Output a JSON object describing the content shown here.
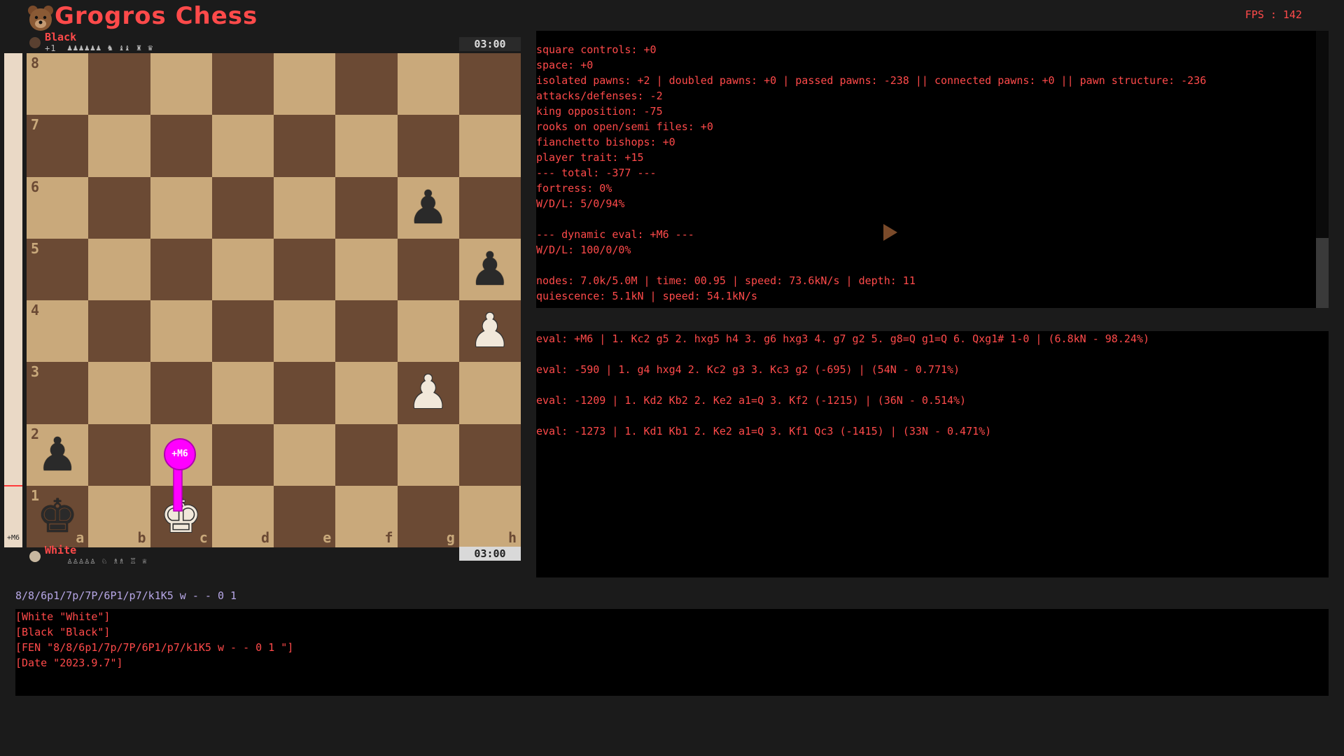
{
  "app": {
    "title": "Grogros Chess",
    "fps": "FPS : 142"
  },
  "players": {
    "top": {
      "name": "Black",
      "material_diff": "+1",
      "captured": "♟♟♟♟♟♟ ♞ ♝♝ ♜ ♛",
      "clock": "03:00"
    },
    "bottom": {
      "name": "White",
      "captured": "♙♙♙♙♙ ♘ ♗♗ ♖ ♕",
      "clock": "03:00"
    }
  },
  "eval_bar": {
    "label": "+M6",
    "white_share_percent": 88
  },
  "board": {
    "ranks": [
      "8",
      "7",
      "6",
      "5",
      "4",
      "3",
      "2",
      "1"
    ],
    "files": [
      "a",
      "b",
      "c",
      "d",
      "e",
      "f",
      "g",
      "h"
    ],
    "pieces": [
      {
        "square": "g6",
        "glyph": "♟",
        "color": "black"
      },
      {
        "square": "h5",
        "glyph": "♟",
        "color": "black"
      },
      {
        "square": "h4",
        "glyph": "♟",
        "color": "white"
      },
      {
        "square": "g3",
        "glyph": "♟",
        "color": "white"
      },
      {
        "square": "a2",
        "glyph": "♟",
        "color": "black"
      },
      {
        "square": "a1",
        "glyph": "♚",
        "color": "black"
      },
      {
        "square": "c1",
        "glyph": "♚",
        "color": "white"
      }
    ],
    "arrow": {
      "from": "c1",
      "to": "c2",
      "label": "+M6",
      "color": "#ff00ff"
    }
  },
  "analysis": {
    "info_lines": [
      "square controls: +0",
      "space: +0",
      "isolated pawns: +2 | doubled pawns: +0 | passed pawns: -238 || connected pawns: +0 || pawn structure: -236",
      "attacks/defenses: -2",
      "king opposition: -75",
      "rooks on open/semi files: +0",
      "fianchetto bishops: +0",
      "player trait: +15",
      "--- total: -377 ---",
      "fortress: 0%",
      "W/D/L: 5/0/94%",
      "",
      "--- dynamic eval: +M6 ---",
      "W/D/L: 100/0/0%",
      "",
      "nodes: 7.0k/5.0M | time: 00.95 | speed: 73.6kN/s | depth: 11",
      "quiescence: 5.1kN | speed: 54.1kN/s"
    ],
    "variations": [
      "eval: +M6 | 1. Kc2 g5 2. hxg5 h4 3. g6 hxg3 4. g7 g2 5. g8=Q g1=Q 6. Qxg1# 1-0 | (6.8kN - 98.24%)",
      "",
      "eval: -590 | 1. g4 hxg4 2. Kc2 g3 3. Kc3 g2 (-695) | (54N - 0.771%)",
      "",
      "eval: -1209 | 1. Kd2 Kb2 2. Ke2 a1=Q 3. Kf2 (-1215) | (36N - 0.514%)",
      "",
      "eval: -1273 | 1. Kd1 Kb1 2. Ke2 a1=Q 3. Kf1 Qc3 (-1415) | (33N - 0.471%)"
    ]
  },
  "fen": "8/8/6p1/7p/7P/6P1/p7/k1K5 w - - 0 1",
  "pgn_lines": [
    "[White \"White\"]",
    "[Black \"Black\"]",
    "[FEN \"8/8/6p1/7p/7P/6P1/p7/k1K5 w - - 0 1 \"]",
    "[Date \"2023.9.7\"]"
  ],
  "colors": {
    "accent": "#ff4a4a",
    "light_square": "#c9a97b",
    "dark_square": "#6b4a34",
    "arrow": "#ff00ff",
    "fen_text": "#b7a7e6"
  },
  "icons": {
    "logo": "bear-logo-icon",
    "play": "play-cursor-icon"
  }
}
